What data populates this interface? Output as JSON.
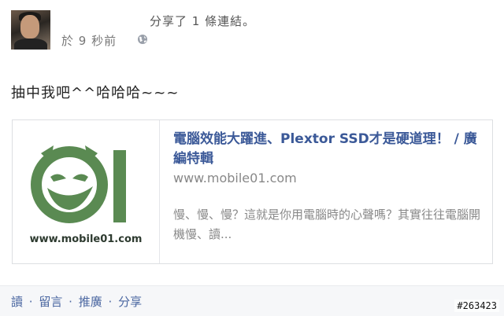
{
  "post": {
    "shared_text": "分享了 1 條連結。",
    "timestamp": "於 9 秒前",
    "privacy_icon": "globe-icon",
    "status": "抽中我吧^^哈哈哈~~~"
  },
  "link_card": {
    "thumbnail_url_text": "www.mobile01.com",
    "title": "電腦效能大躍進、Plextor SSD才是硬道理！ / 廣編特輯",
    "domain": "www.mobile01.com",
    "description": "慢、慢、慢？這就是你用電腦時的心聲嗎？其實往往電腦開機慢、讀..."
  },
  "actions": {
    "read": "讀",
    "comment": "留言",
    "promote": "推廣",
    "share": "分享",
    "separator": "·"
  },
  "watermark": "#263423",
  "colors": {
    "link_blue": "#3b5998",
    "logo_green": "#5a8a52"
  }
}
